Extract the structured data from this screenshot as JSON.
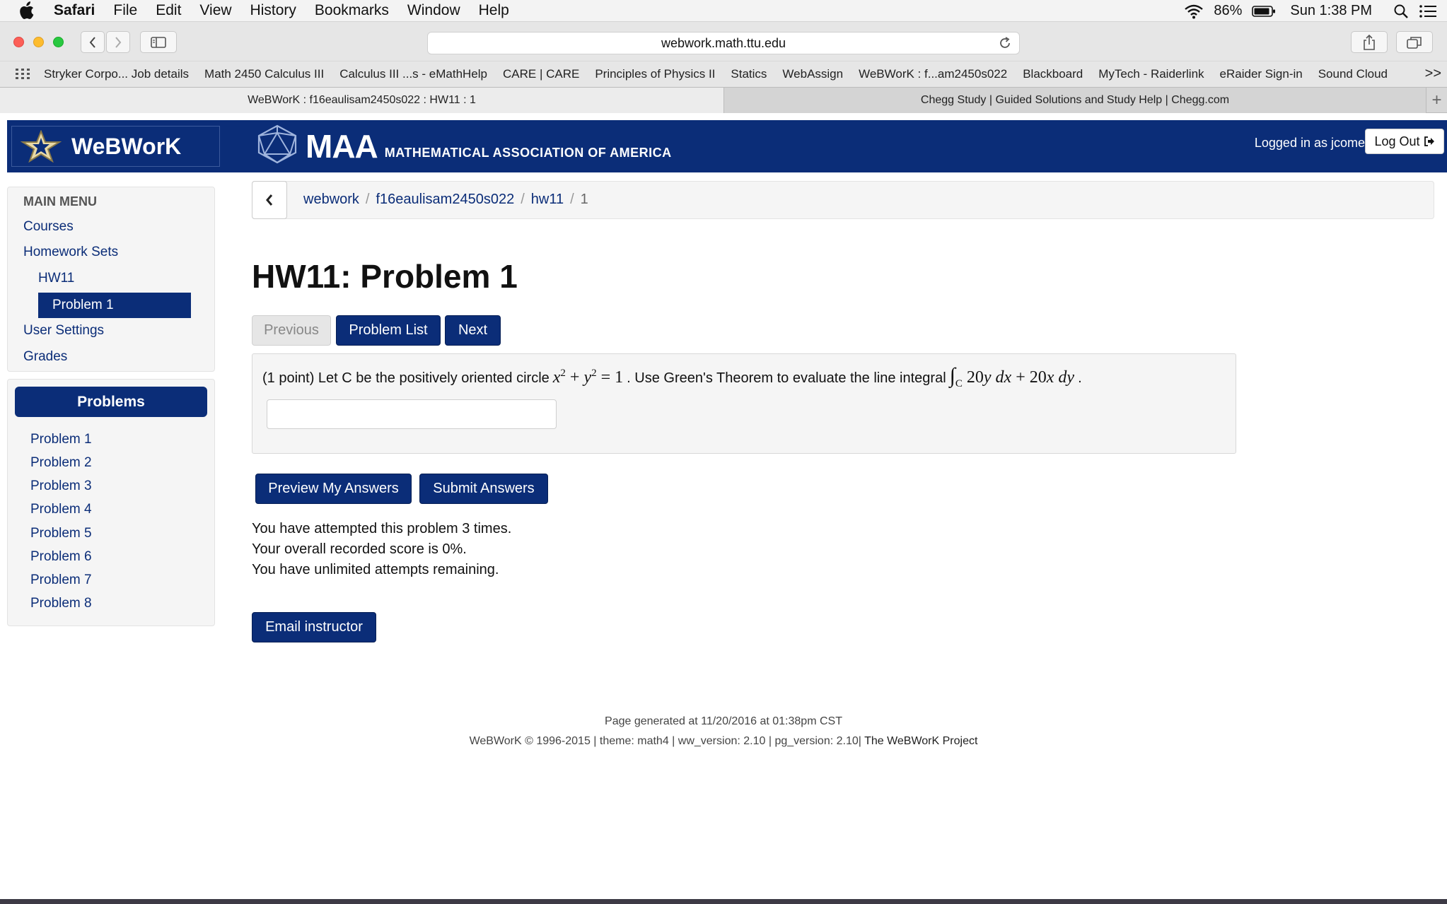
{
  "menubar": {
    "app": "Safari",
    "items": [
      "File",
      "Edit",
      "View",
      "History",
      "Bookmarks",
      "Window",
      "Help"
    ],
    "battery": "86%",
    "clock": "Sun 1:38 PM"
  },
  "toolbar": {
    "url": "webwork.math.ttu.edu"
  },
  "bookmarks": [
    "Stryker Corpo... Job details",
    "Math 2450 Calculus III",
    "Calculus III ...s - eMathHelp",
    "CARE | CARE",
    "Principles of Physics II",
    "Statics",
    "WebAssign",
    "WeBWorK : f...am2450s022",
    "Blackboard",
    "MyTech - Raiderlink",
    "eRaider Sign-in",
    "Sound Cloud"
  ],
  "tabs": {
    "active": "WeBWorK : f16eaulisam2450s022 : HW11 : 1",
    "inactive": "Chegg Study | Guided Solutions and Study Help | Chegg.com"
  },
  "header": {
    "logo": "WeBWorK",
    "maa_big": "MAA",
    "maa_small": "MATHEMATICAL ASSOCIATION OF AMERICA",
    "logged_in": "Logged in as jcomerfo.",
    "logout": "Log Out"
  },
  "sidebar": {
    "heading": "MAIN MENU",
    "courses": "Courses",
    "homework_sets": "Homework Sets",
    "set": "HW11",
    "problem": "Problem 1",
    "user_settings": "User Settings",
    "grades": "Grades"
  },
  "problems_panel": {
    "title": "Problems",
    "items": [
      "Problem 1",
      "Problem 2",
      "Problem 3",
      "Problem 4",
      "Problem 5",
      "Problem 6",
      "Problem 7",
      "Problem 8"
    ]
  },
  "breadcrumb": [
    "webwork",
    "f16eaulisam2450s022",
    "hw11",
    "1"
  ],
  "page_title": "HW11: Problem 1",
  "nav": {
    "previous": "Previous",
    "problem_list": "Problem List",
    "next": "Next"
  },
  "problem": {
    "intro": "(1 point) Let C be the positively oriented circle",
    "middle": ". Use Green's Theorem to evaluate the line integral",
    "end": ".",
    "answer_value": ""
  },
  "actions": {
    "preview": "Preview My Answers",
    "submit": "Submit Answers"
  },
  "attempts": {
    "line1": "You have attempted this problem 3 times.",
    "line2": "Your overall recorded score is 0%.",
    "line3": "You have unlimited attempts remaining."
  },
  "email_instructor": "Email instructor",
  "footer": {
    "generated": "Page generated at 11/20/2016 at 01:38pm CST",
    "meta": "WeBWorK © 1996-2015 | theme: math4 | ww_version: 2.10 | pg_version: 2.10|",
    "project": "The WeBWorK Project"
  }
}
